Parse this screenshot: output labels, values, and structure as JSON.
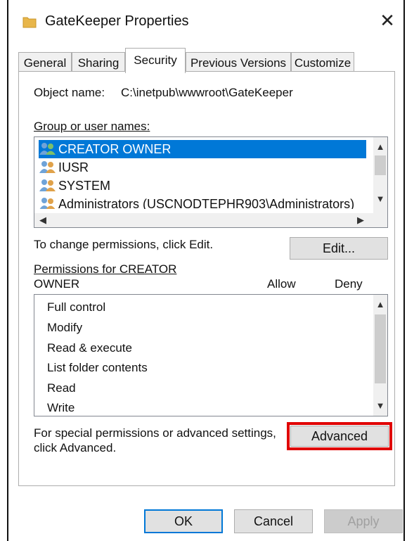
{
  "window": {
    "title": "GateKeeper Properties",
    "close_glyph": "✕",
    "folder_color": "#e8b64a"
  },
  "tabs": [
    {
      "label": "General"
    },
    {
      "label": "Sharing"
    },
    {
      "label": "Security"
    },
    {
      "label": "Previous Versions"
    },
    {
      "label": "Customize"
    }
  ],
  "security": {
    "object_name_label": "Object name:",
    "object_name_value": "C:\\inetpub\\wwwroot\\GateKeeper",
    "group_label": "Group or user names:",
    "users": [
      {
        "name": "CREATOR OWNER"
      },
      {
        "name": "IUSR"
      },
      {
        "name": "SYSTEM"
      },
      {
        "name": "Administrators (USCNODTEPHR903\\Administrators)"
      }
    ],
    "change_text": "To change permissions, click Edit.",
    "edit_button": "Edit...",
    "permissions_for_line1": "Permissions for CREATOR",
    "permissions_for_line2": "OWNER",
    "allow_header": "Allow",
    "deny_header": "Deny",
    "permissions": [
      {
        "name": "Full control"
      },
      {
        "name": "Modify"
      },
      {
        "name": "Read & execute"
      },
      {
        "name": "List folder contents"
      },
      {
        "name": "Read"
      },
      {
        "name": "Write"
      }
    ],
    "special_line1": "For special permissions or advanced settings,",
    "special_line2": "click Advanced.",
    "advanced_button": "Advanced"
  },
  "footer": {
    "ok": "OK",
    "cancel": "Cancel",
    "apply": "Apply"
  },
  "colors": {
    "selection": "#0078d7",
    "highlight": "#e00000"
  }
}
